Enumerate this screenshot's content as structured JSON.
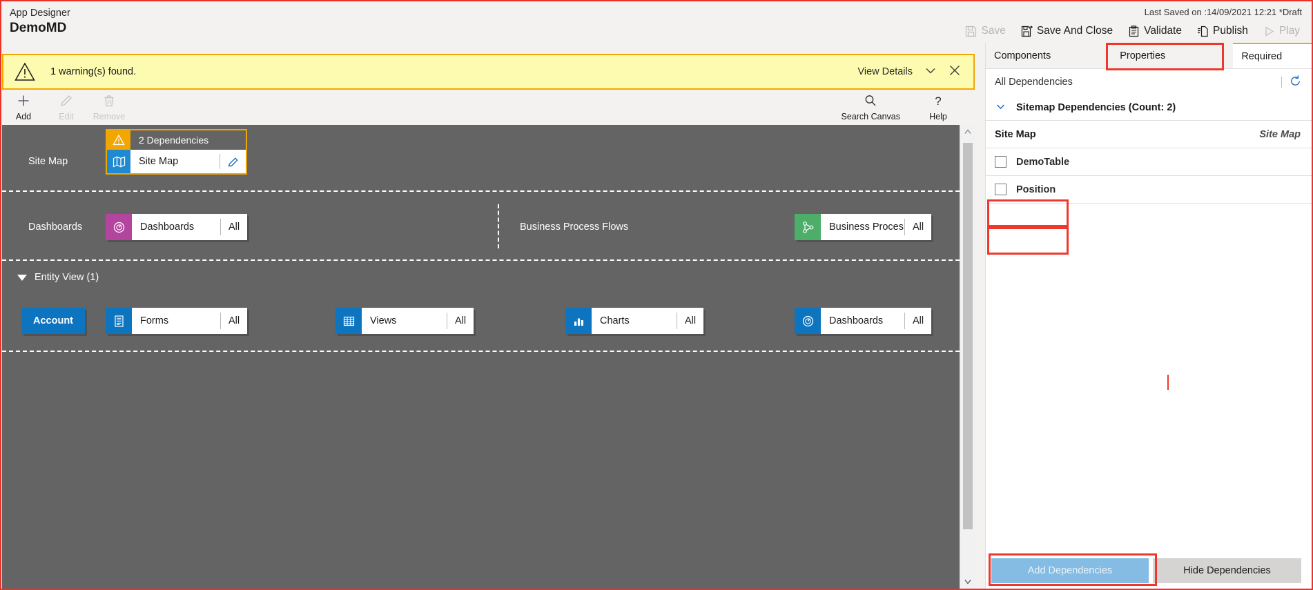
{
  "header": {
    "app_label": "App Designer",
    "title": "DemoMD",
    "last_saved": "Last Saved on :14/09/2021 12:21 *Draft",
    "commands": [
      {
        "label": "Save",
        "icon": "save-icon",
        "disabled": true
      },
      {
        "label": "Save And Close",
        "icon": "save-and-close-icon",
        "disabled": false
      },
      {
        "label": "Validate",
        "icon": "validate-clipboard-icon",
        "disabled": false
      },
      {
        "label": "Publish",
        "icon": "publish-icon",
        "disabled": false
      },
      {
        "label": "Play",
        "icon": "play-triangle-icon",
        "disabled": true
      }
    ]
  },
  "warning_bar": {
    "message": "1 warning(s) found.",
    "view_details_label": "View Details",
    "icon": "warning-triangle-icon",
    "border_color": "#f2a700",
    "background_color": "#fdfbaf"
  },
  "command_bar": {
    "buttons": [
      {
        "label": "Add",
        "icon": "plus-icon",
        "disabled": false
      },
      {
        "label": "Edit",
        "icon": "pencil-icon",
        "disabled": true
      },
      {
        "label": "Remove",
        "icon": "trash-icon",
        "disabled": true
      }
    ],
    "right_buttons": [
      {
        "label": "Search Canvas",
        "icon": "search-icon"
      },
      {
        "label": "Help",
        "icon": "question-mark-icon"
      }
    ]
  },
  "canvas": {
    "background_color": "#646464",
    "rows": [
      {
        "label": "Site Map",
        "sitemap": {
          "dependency_banner": "2 Dependencies",
          "banner_icon": "warning-triangle-icon",
          "tile_label": "Site Map",
          "tile_icon": "map-icon",
          "edit_icon": "pencil-icon",
          "icon_color": "#1f8ad2",
          "highlight_color": "#f2a700"
        }
      },
      {
        "label": "Dashboards",
        "tiles": [
          {
            "name": "Dashboards",
            "count": "All",
            "icon": "dashboard-gauge-icon",
            "icon_color": "#b4459e"
          }
        ],
        "label2": "Business Process Flows",
        "tiles2": [
          {
            "name": "Business Proces...",
            "count": "All",
            "icon": "process-flow-icon",
            "icon_color": "#4cae68"
          }
        ]
      },
      {
        "label": "Entity View (1)",
        "entity_pill": "Account",
        "entity_pill_color": "#0d74c0",
        "tiles": [
          {
            "name": "Forms",
            "count": "All",
            "icon": "form-icon",
            "icon_color": "#0d74c0"
          },
          {
            "name": "Views",
            "count": "All",
            "icon": "grid-view-icon",
            "icon_color": "#0d74c0"
          },
          {
            "name": "Charts",
            "count": "All",
            "icon": "bar-chart-icon",
            "icon_color": "#0d74c0"
          },
          {
            "name": "Dashboards",
            "count": "All",
            "icon": "dashboard-gauge-icon",
            "icon_color": "#0d74c0"
          }
        ]
      }
    ]
  },
  "right_panel": {
    "tabs": [
      {
        "label": "Components",
        "active": false
      },
      {
        "label": "Properties",
        "active": false
      },
      {
        "label": "Required",
        "active": true
      }
    ],
    "all_dependencies_label": "All Dependencies",
    "refresh_icon": "refresh-icon",
    "group": {
      "label": "Sitemap Dependencies (Count: 2)",
      "expanded": true,
      "chevron_icon": "chevron-down-icon"
    },
    "table": {
      "head": {
        "name": "Site Map",
        "type": "Site Map"
      },
      "rows": [
        {
          "name": "DemoTable",
          "checked": false
        },
        {
          "name": "Position",
          "checked": false
        }
      ]
    },
    "footer": {
      "add_label": "Add Dependencies",
      "add_disabled": true,
      "hide_label": "Hide Dependencies"
    }
  },
  "annotations": {
    "color": "#f0372c",
    "boxes": [
      "required-tab",
      "demotable-row",
      "position-row",
      "add-dependencies-button"
    ]
  }
}
